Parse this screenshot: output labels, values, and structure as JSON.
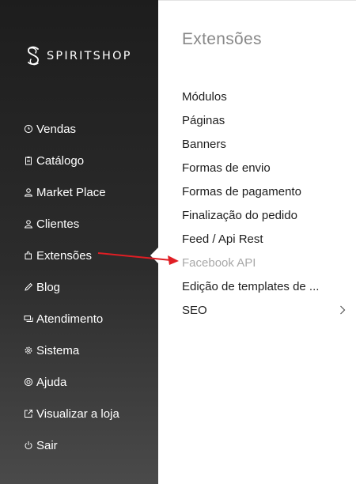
{
  "brand": {
    "name": "SPIRITSHOP",
    "logo_icon": "spiritshop-logo-icon"
  },
  "sidebar": {
    "items": [
      {
        "label": "Vendas",
        "icon": "clock-icon"
      },
      {
        "label": "Catálogo",
        "icon": "clipboard-icon"
      },
      {
        "label": "Market Place",
        "icon": "user-icon"
      },
      {
        "label": "Clientes",
        "icon": "user-icon"
      },
      {
        "label": "Extensões",
        "icon": "puzzle-icon",
        "active": true
      },
      {
        "label": "Blog",
        "icon": "pencil-icon"
      },
      {
        "label": "Atendimento",
        "icon": "chat-icon"
      },
      {
        "label": "Sistema",
        "icon": "gear-icon"
      },
      {
        "label": "Ajuda",
        "icon": "lifebuoy-icon"
      },
      {
        "label": "Visualizar a loja",
        "icon": "external-link-icon"
      },
      {
        "label": "Sair",
        "icon": "power-icon"
      }
    ]
  },
  "submenu": {
    "title": "Extensões",
    "items": [
      {
        "label": "Módulos"
      },
      {
        "label": "Páginas"
      },
      {
        "label": "Banners"
      },
      {
        "label": "Formas de envio"
      },
      {
        "label": "Formas de pagamento"
      },
      {
        "label": "Finalização do pedido"
      },
      {
        "label": "Feed / Api Rest"
      },
      {
        "label": "Facebook API",
        "muted": true
      },
      {
        "label": "Edição de templates de ..."
      },
      {
        "label": "SEO",
        "has_submenu": true,
        "icon": "chevron-right-icon"
      }
    ]
  },
  "annotation": {
    "icon": "red-arrow-icon",
    "color": "#e01e24"
  },
  "colors": {
    "sidebar": "#252525",
    "panel": "#ffffff",
    "title": "#888888",
    "muted_item": "#a8a8a8"
  }
}
